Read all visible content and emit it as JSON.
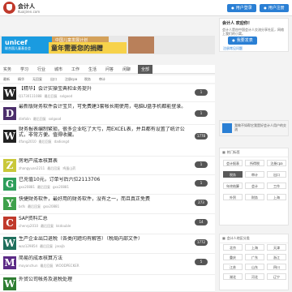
{
  "header": {
    "site_name": "会计人",
    "domain": "Kuaijiren.com",
    "login_label": "用户登录",
    "register_label": "用户注册"
  },
  "banner": {
    "brand": "unicef",
    "brand_sub": "联合国儿童基金会",
    "top_text": "中国儿童发展计划",
    "slogan": "童年需要您的捐赠"
  },
  "category_tabs": [
    "实务",
    "学习",
    "行业",
    "城市",
    "工作",
    "生活",
    "问答",
    "闲聊",
    "全部"
  ],
  "active_tab": "全部",
  "sub_tabs": [
    "最新",
    "精华",
    "无回复",
    "出口",
    "注册cpa",
    "税务",
    "审计"
  ],
  "posts": [
    {
      "letter": "W",
      "color": "#222222",
      "title": "【精华】会计实操宝典和业务提升",
      "meta": [
        "Q1730111088",
        "最后回复",
        "sxlgood"
      ],
      "count": "1"
    },
    {
      "letter": "D",
      "color": "#4b2e6b",
      "title": "最新版财务软件会计宝贝，可免费建3套帐长期使用，电脑U盘手机都能登录。",
      "meta": [
        "dinfolin",
        "最后回复",
        "sxlgood"
      ],
      "count": "1",
      "two": true
    },
    {
      "letter": "W",
      "color": "#222222",
      "title": "财务报表编制繁琐，很多企业吃了大亏，用EXCEL表，并且都有设置了统计公式，非常方便。值得收藏。",
      "meta": [
        "4fang2010",
        "最后回复",
        "dadiongd"
      ],
      "count": "1778",
      "two": true
    },
    {
      "letter": "Z",
      "color": "#c9c83a",
      "title": "房地产成本核算表",
      "meta": [
        "zhangyuan2211",
        "最后回复",
        "鸡蛋山药"
      ],
      "count": "1"
    },
    {
      "letter": "G",
      "color": "#2e9e5b",
      "title": "已充值10元，订单号后六位2113706",
      "meta": [
        "gxx20881",
        "最后回复",
        "gxx20881"
      ],
      "count": "1"
    },
    {
      "letter": "Y",
      "color": "#3fa14b",
      "title": "快捷财务软件，最好用的财务软件，没有之一，而且真正免费",
      "meta": [
        "bsfs",
        "最后回复",
        "gxx20881"
      ],
      "count": "273"
    },
    {
      "letter": "C",
      "color": "#c0392b",
      "title": "SAP资料汇总",
      "meta": [
        "chenrp2010",
        "最后回复",
        "kkdouble"
      ],
      "count": "14"
    },
    {
      "letter": "W",
      "color": "#1f6f5c",
      "title": "生产企业出口退税（各类问题均有解答）（税局内部文件）",
      "meta": [
        "waz129854",
        "最后回复",
        "jasxjb"
      ],
      "count": "1772"
    },
    {
      "letter": "M",
      "color": "#5b2a86",
      "title": "简易的成本核算方法",
      "meta": [
        "moyanchun",
        "最后回复",
        "WOODPECKER"
      ],
      "count": "5"
    },
    {
      "letter": "W",
      "color": "#2e7d32",
      "title": "外贸公司帐务及退税处理",
      "meta": [],
      "count": ""
    }
  ],
  "sidebar": {
    "welcome": "会计人 欢迎你！",
    "welcome_text": "会计人是由中国会计人交流分享社区，网络上我们的小窝。",
    "publish_label": "我要发表",
    "notice_label": "注册常见问题",
    "ad_text": "我做不如帮它我是好会计人用户的交流",
    "hot_title": "热门标签",
    "tags": [
      "会计报表",
      "所得税",
      "注册cpa",
      "税务",
      "审计",
      "出口",
      "年终结算",
      "会计",
      "工作",
      "外贸",
      "财务",
      "上海"
    ],
    "area_title": "会计人地区分类",
    "areas": [
      "北京",
      "上海",
      "天津",
      "重庆",
      "广东",
      "浙江",
      "江苏",
      "山东",
      "四川",
      "湖北",
      "河北",
      "辽宁"
    ]
  }
}
